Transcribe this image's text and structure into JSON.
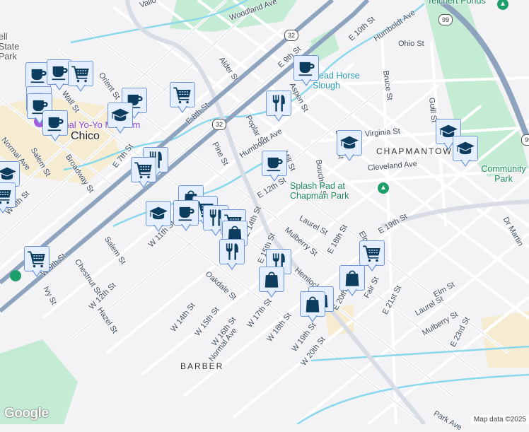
{
  "map": {
    "labels": {
      "vallombrosa": "Vallo",
      "woodland": "Woodland Ave",
      "e10th": "E 10th St",
      "humboldt_n": "Humboldt Ave",
      "ohio": "Ohio St",
      "alder": "Alder St",
      "orient": "Orient St",
      "wall": "Wall St",
      "e8th": "E 8th St",
      "e9th": "E 9th St",
      "aspen": "Aspen St",
      "bruce": "Bruce St",
      "poplar": "Poplar St",
      "guill": "Guill St",
      "humboldt_s": "Humboldt Ave",
      "pine": "Pine St",
      "mill": "Mill St",
      "boucher": "Boucher St",
      "davis": "Davis St",
      "virginia": "Virginia St",
      "cleveland": "Cleveland Ave",
      "e12th": "E 12th St",
      "normal_n": "Normal Ave",
      "salem_n": "Salem St",
      "broadway": "Broadway St",
      "e7th": "E 7th St",
      "w6th": "W 6th St",
      "salem_s": "Salem St",
      "chestnut": "Chestnut St",
      "w11th": "W 11th St",
      "w9th": "W 9th St",
      "ivy": "Ivy St",
      "w12th": "W 12th St",
      "hazel": "Hazel St",
      "oakdale": "Oakdale St",
      "w14th": "W 14th St",
      "w15th": "W 15th St",
      "w16th": "W 16th St",
      "normal_s": "Normal Ave",
      "w17th": "W 17th St",
      "w18th": "W 18th St",
      "w19th": "W 19th St",
      "w20th": "W 20th St",
      "e15th": "E 15th St",
      "e14th": "E 14th St",
      "mulberry_n": "Mulberry St",
      "hemlock": "Hemlock St",
      "laurel_n": "Laurel St",
      "e18th": "E 18th St",
      "elm_n": "Elm St",
      "e19th": "E 19th St",
      "e20th": "E 20th St",
      "fair": "Fair St",
      "e21st": "E 21st St",
      "elm_s": "Elm St",
      "laurel_s": "Laurel St",
      "mulberry_s": "Mulberry St",
      "e23rd": "E 23rd St",
      "park_ave": "Park Ave",
      "dr_martin": "Dr Martin"
    },
    "places": {
      "museum": "National Yo-Yo Museum",
      "city": "Chico",
      "slough": "Dead Horse Slough",
      "chapmantown": "CHAPMANTOWN",
      "barber": "BARBER",
      "community_park": "Community Park",
      "splash_pad": "Splash Pad at Chapman Park",
      "teichert": "Teichert Ponds",
      "bidwell": "ell State Park"
    },
    "shields": {
      "r32a": "32",
      "r32b": "32",
      "r99a": "99",
      "r99b": "99"
    },
    "marker_types": [
      "coffee",
      "coffee",
      "cart",
      "coffee",
      "coffee",
      "coffee",
      "cart",
      "coffee",
      "grad",
      "fork",
      "coffee",
      "grad",
      "grad",
      "grad",
      "coffee",
      "fork",
      "cart",
      "grad",
      "cart",
      "bag",
      "cart",
      "grad",
      "coffee",
      "fork",
      "cart",
      "bag",
      "fork",
      "cart",
      "fork",
      "bag",
      "bag",
      "bag",
      "bag",
      "cart"
    ],
    "colors": {
      "marker_fill": "#e6efff",
      "marker_border": "#6d97d9",
      "icon": "#0d3d5e",
      "highway": "#8ea3bd",
      "park": "#c4ecd5",
      "water": "#8ad8ec"
    }
  },
  "attribution": {
    "logo": "Google",
    "map_data": "Map data ©2025"
  }
}
